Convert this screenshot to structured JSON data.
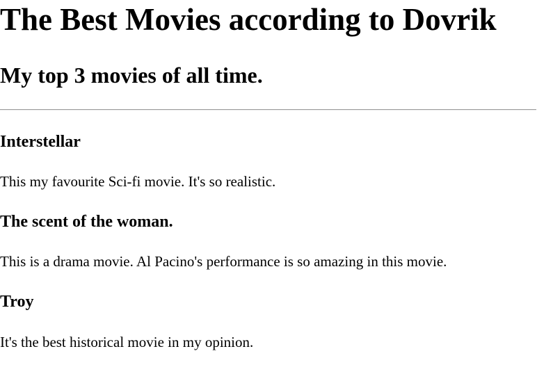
{
  "header": {
    "title": "The Best Movies according to Dovrik",
    "subtitle": "My top 3 movies of all time."
  },
  "movies": [
    {
      "title": "Interstellar",
      "description": "This my favourite Sci-fi movie. It's so realistic."
    },
    {
      "title": "The scent of the woman.",
      "description": "This is a drama movie. Al Pacino's performance is so amazing in this movie."
    },
    {
      "title": "Troy",
      "description": "It's the best historical movie in my opinion."
    }
  ]
}
